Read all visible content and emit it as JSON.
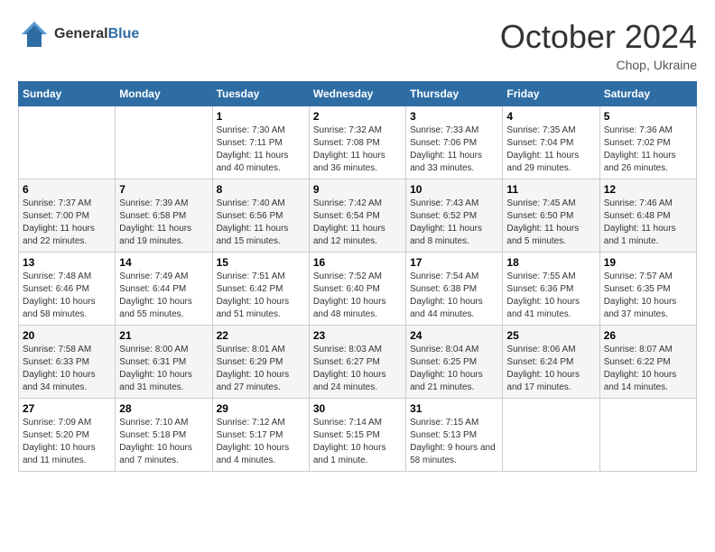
{
  "header": {
    "logo_general": "General",
    "logo_blue": "Blue",
    "month_title": "October 2024",
    "location": "Chop, Ukraine"
  },
  "days_of_week": [
    "Sunday",
    "Monday",
    "Tuesday",
    "Wednesday",
    "Thursday",
    "Friday",
    "Saturday"
  ],
  "weeks": [
    [
      {
        "day": "",
        "sunrise": "",
        "sunset": "",
        "daylight": ""
      },
      {
        "day": "",
        "sunrise": "",
        "sunset": "",
        "daylight": ""
      },
      {
        "day": "1",
        "sunrise": "Sunrise: 7:30 AM",
        "sunset": "Sunset: 7:11 PM",
        "daylight": "Daylight: 11 hours and 40 minutes."
      },
      {
        "day": "2",
        "sunrise": "Sunrise: 7:32 AM",
        "sunset": "Sunset: 7:08 PM",
        "daylight": "Daylight: 11 hours and 36 minutes."
      },
      {
        "day": "3",
        "sunrise": "Sunrise: 7:33 AM",
        "sunset": "Sunset: 7:06 PM",
        "daylight": "Daylight: 11 hours and 33 minutes."
      },
      {
        "day": "4",
        "sunrise": "Sunrise: 7:35 AM",
        "sunset": "Sunset: 7:04 PM",
        "daylight": "Daylight: 11 hours and 29 minutes."
      },
      {
        "day": "5",
        "sunrise": "Sunrise: 7:36 AM",
        "sunset": "Sunset: 7:02 PM",
        "daylight": "Daylight: 11 hours and 26 minutes."
      }
    ],
    [
      {
        "day": "6",
        "sunrise": "Sunrise: 7:37 AM",
        "sunset": "Sunset: 7:00 PM",
        "daylight": "Daylight: 11 hours and 22 minutes."
      },
      {
        "day": "7",
        "sunrise": "Sunrise: 7:39 AM",
        "sunset": "Sunset: 6:58 PM",
        "daylight": "Daylight: 11 hours and 19 minutes."
      },
      {
        "day": "8",
        "sunrise": "Sunrise: 7:40 AM",
        "sunset": "Sunset: 6:56 PM",
        "daylight": "Daylight: 11 hours and 15 minutes."
      },
      {
        "day": "9",
        "sunrise": "Sunrise: 7:42 AM",
        "sunset": "Sunset: 6:54 PM",
        "daylight": "Daylight: 11 hours and 12 minutes."
      },
      {
        "day": "10",
        "sunrise": "Sunrise: 7:43 AM",
        "sunset": "Sunset: 6:52 PM",
        "daylight": "Daylight: 11 hours and 8 minutes."
      },
      {
        "day": "11",
        "sunrise": "Sunrise: 7:45 AM",
        "sunset": "Sunset: 6:50 PM",
        "daylight": "Daylight: 11 hours and 5 minutes."
      },
      {
        "day": "12",
        "sunrise": "Sunrise: 7:46 AM",
        "sunset": "Sunset: 6:48 PM",
        "daylight": "Daylight: 11 hours and 1 minute."
      }
    ],
    [
      {
        "day": "13",
        "sunrise": "Sunrise: 7:48 AM",
        "sunset": "Sunset: 6:46 PM",
        "daylight": "Daylight: 10 hours and 58 minutes."
      },
      {
        "day": "14",
        "sunrise": "Sunrise: 7:49 AM",
        "sunset": "Sunset: 6:44 PM",
        "daylight": "Daylight: 10 hours and 55 minutes."
      },
      {
        "day": "15",
        "sunrise": "Sunrise: 7:51 AM",
        "sunset": "Sunset: 6:42 PM",
        "daylight": "Daylight: 10 hours and 51 minutes."
      },
      {
        "day": "16",
        "sunrise": "Sunrise: 7:52 AM",
        "sunset": "Sunset: 6:40 PM",
        "daylight": "Daylight: 10 hours and 48 minutes."
      },
      {
        "day": "17",
        "sunrise": "Sunrise: 7:54 AM",
        "sunset": "Sunset: 6:38 PM",
        "daylight": "Daylight: 10 hours and 44 minutes."
      },
      {
        "day": "18",
        "sunrise": "Sunrise: 7:55 AM",
        "sunset": "Sunset: 6:36 PM",
        "daylight": "Daylight: 10 hours and 41 minutes."
      },
      {
        "day": "19",
        "sunrise": "Sunrise: 7:57 AM",
        "sunset": "Sunset: 6:35 PM",
        "daylight": "Daylight: 10 hours and 37 minutes."
      }
    ],
    [
      {
        "day": "20",
        "sunrise": "Sunrise: 7:58 AM",
        "sunset": "Sunset: 6:33 PM",
        "daylight": "Daylight: 10 hours and 34 minutes."
      },
      {
        "day": "21",
        "sunrise": "Sunrise: 8:00 AM",
        "sunset": "Sunset: 6:31 PM",
        "daylight": "Daylight: 10 hours and 31 minutes."
      },
      {
        "day": "22",
        "sunrise": "Sunrise: 8:01 AM",
        "sunset": "Sunset: 6:29 PM",
        "daylight": "Daylight: 10 hours and 27 minutes."
      },
      {
        "day": "23",
        "sunrise": "Sunrise: 8:03 AM",
        "sunset": "Sunset: 6:27 PM",
        "daylight": "Daylight: 10 hours and 24 minutes."
      },
      {
        "day": "24",
        "sunrise": "Sunrise: 8:04 AM",
        "sunset": "Sunset: 6:25 PM",
        "daylight": "Daylight: 10 hours and 21 minutes."
      },
      {
        "day": "25",
        "sunrise": "Sunrise: 8:06 AM",
        "sunset": "Sunset: 6:24 PM",
        "daylight": "Daylight: 10 hours and 17 minutes."
      },
      {
        "day": "26",
        "sunrise": "Sunrise: 8:07 AM",
        "sunset": "Sunset: 6:22 PM",
        "daylight": "Daylight: 10 hours and 14 minutes."
      }
    ],
    [
      {
        "day": "27",
        "sunrise": "Sunrise: 7:09 AM",
        "sunset": "Sunset: 5:20 PM",
        "daylight": "Daylight: 10 hours and 11 minutes."
      },
      {
        "day": "28",
        "sunrise": "Sunrise: 7:10 AM",
        "sunset": "Sunset: 5:18 PM",
        "daylight": "Daylight: 10 hours and 7 minutes."
      },
      {
        "day": "29",
        "sunrise": "Sunrise: 7:12 AM",
        "sunset": "Sunset: 5:17 PM",
        "daylight": "Daylight: 10 hours and 4 minutes."
      },
      {
        "day": "30",
        "sunrise": "Sunrise: 7:14 AM",
        "sunset": "Sunset: 5:15 PM",
        "daylight": "Daylight: 10 hours and 1 minute."
      },
      {
        "day": "31",
        "sunrise": "Sunrise: 7:15 AM",
        "sunset": "Sunset: 5:13 PM",
        "daylight": "Daylight: 9 hours and 58 minutes."
      },
      {
        "day": "",
        "sunrise": "",
        "sunset": "",
        "daylight": ""
      },
      {
        "day": "",
        "sunrise": "",
        "sunset": "",
        "daylight": ""
      }
    ]
  ]
}
